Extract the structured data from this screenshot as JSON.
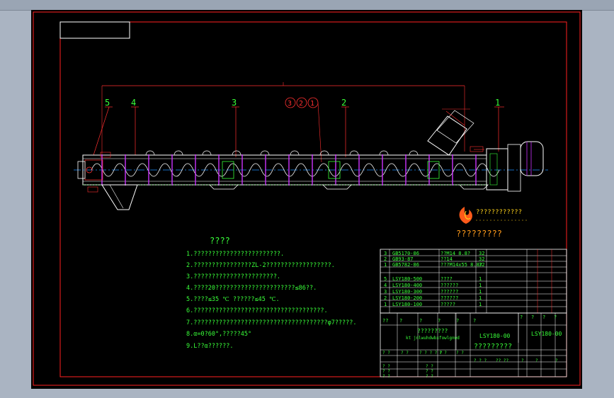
{
  "callouts": [
    "5",
    "4",
    "3",
    "2",
    "1"
  ],
  "circled_callouts": [
    "3",
    "2",
    "1"
  ],
  "tech_requirements": {
    "title": "????",
    "lines": [
      "1.????????????????????????.",
      "2.????????????????ZL-2??????????????????.",
      "3.???????????????????????.",
      "4.????20??????????????????????≤86??.",
      "5.????≤35 ℃ ??????≤45 ℃.",
      "6.????????????????????????????????????.",
      "7.?????????????????????????????????????φ7?????.",
      "8.α=0?60°,?????45°",
      "9.L??α??????."
    ]
  },
  "logo": {
    "line1": "????????????",
    "line2": "?????????"
  },
  "parts_table": {
    "standard_parts": [
      {
        "no": "3",
        "code": "GB5170-86",
        "name": "??M14 8.8?",
        "qty": "32"
      },
      {
        "no": "2",
        "code": "GB93-87",
        "name": "??14",
        "qty": "32"
      },
      {
        "no": "1",
        "code": "GB5782-86",
        "name": "???M14x55 8.8?",
        "qty": "32"
      }
    ],
    "components": [
      {
        "no": "5",
        "code": "LSY180-500",
        "name": "????",
        "qty": "1"
      },
      {
        "no": "4",
        "code": "LSY180-400",
        "name": "??????",
        "qty": "1"
      },
      {
        "no": "3",
        "code": "LSY180-300",
        "name": "??????",
        "qty": "1"
      },
      {
        "no": "2",
        "code": "LSY180-200",
        "name": "??????",
        "qty": "1"
      },
      {
        "no": "1",
        "code": "LSY180-100",
        "name": "?????",
        "qty": "1"
      }
    ],
    "header_cells": [
      "??",
      "?",
      "?",
      "?",
      "?",
      "?"
    ]
  },
  "title_block": {
    "product_name": "?????????",
    "drawing_no_mid": "LSY180-00",
    "drawing_no_right": "LSY180-00",
    "company": "?????????",
    "stage_labels": [
      "?",
      "?",
      "?",
      "?"
    ],
    "sign_row": [
      "? ?",
      "? ?",
      "? ? ? ? ?",
      "? ?",
      "? ?"
    ],
    "bottom_row": [
      "? ? ?",
      "?? ??",
      "?",
      "?",
      "?"
    ],
    "small_caption": "kt jnlwuhdwbxfowlgnwd"
  },
  "colors": {
    "background": "#000000",
    "border": "#ff2020",
    "text": "#39ff39",
    "part": "#ffffff",
    "accent": "#cc33ff",
    "axis": "#1e90ff"
  }
}
